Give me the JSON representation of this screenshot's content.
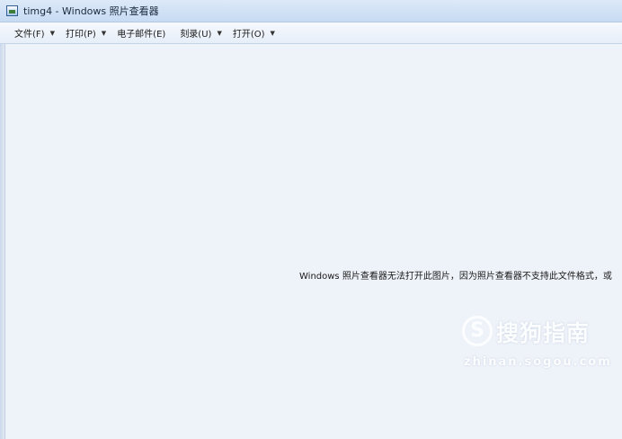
{
  "window": {
    "title": "timg4 - Windows 照片查看器"
  },
  "menubar": {
    "items": [
      {
        "label": "文件(F)",
        "has_dropdown": true
      },
      {
        "label": "打印(P)",
        "has_dropdown": true
      },
      {
        "label": "电子邮件(E)",
        "has_dropdown": false
      },
      {
        "label": "刻录(U)",
        "has_dropdown": true
      },
      {
        "label": "打开(O)",
        "has_dropdown": true
      }
    ]
  },
  "content": {
    "message": "Windows 照片查看器无法打开此图片，因为照片查看器不支持此文件格式，或"
  },
  "watermark": {
    "logo_letter": "S",
    "brand": "搜狗指南",
    "url": "zhinan.sogou.com"
  },
  "colors": {
    "titlebar": "#c7dbf3",
    "menubar": "#e6eef8",
    "content_bg": "#eef2f9"
  }
}
